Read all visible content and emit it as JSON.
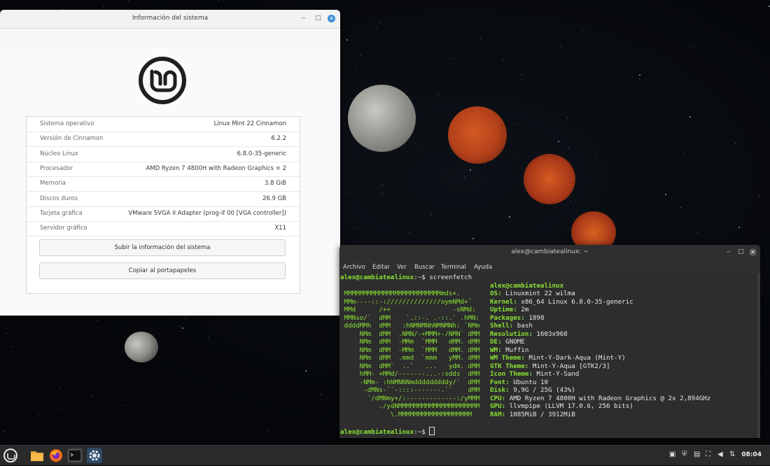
{
  "sysinfo": {
    "title": "Información del sistema",
    "rows": [
      {
        "label": "Sistema operativo",
        "value": "Linux Mint 22 Cinnamon"
      },
      {
        "label": "Versión de Cinnamon",
        "value": "6.2.2"
      },
      {
        "label": "Núcleo Linux",
        "value": "6.8.0-35-generic"
      },
      {
        "label": "Procesador",
        "value": "AMD Ryzen 7 4800H with Radeon Graphics × 2"
      },
      {
        "label": "Memoria",
        "value": "3.8 GiB"
      },
      {
        "label": "Discos duros",
        "value": "26.9 GB"
      },
      {
        "label": "Tarjeta gráfica",
        "value": "VMware SVGA II Adapter (prog-if 00 [VGA controller])"
      },
      {
        "label": "Servidor gráfico",
        "value": "X11"
      }
    ],
    "upload_button": "Subir la información del sistema",
    "copy_button": "Copiar al portapapeles"
  },
  "terminal": {
    "title": "alex@cambiatealinux: ~",
    "menu": [
      "Archivo",
      "Editar",
      "Ver",
      "Buscar",
      "Terminal",
      "Ayuda"
    ],
    "prompt": "alex@cambiatealinux",
    "prompt_suffix": ":~$ ",
    "command": "screenfetch",
    "logo_lines": [
      " MMMMMMMMMMMMMMMMMMMMMMMMMmds+.",
      " MMm----::-://////////////oymNMd+`",
      " MMd      /++                -sNMd:",
      " MMNso/`  dMM    `.::-. .-::.` .hMN:",
      " ddddMMh  dMM   :hNMNMNhNMNMNh: `NMm",
      "     NMm  dMM  .NMN/-+MMM+-/NMN` dMM",
      "     NMm  dMM  -MMm  `MMM   dMM. dMM",
      "     NMm  dMM  -MMm  `MMM   dMM. dMM",
      "     NMm  dMM  .mmd  `mmm   yMM. dMM",
      "     NMm  dMM`  ..`   ...   ydm. dMM",
      "     hMM- +MMd/-------...-:sdds  dMM",
      "     -NMm- :hNMNNNmdddddddddy/`  dMM",
      "      -dMNs-``-::::-------.``    dMM",
      "       `/dMNmy+/:-------------:/yMMM",
      "          ./ydNMMMMMMMMMMMMMMMMMMMMM",
      "             \\.MMMMMMMMMMMMMMMMMMM"
    ],
    "user_host": "alex@cambiatealinux",
    "info": [
      {
        "key": "OS",
        "value": "Linuxmint 22 wilma"
      },
      {
        "key": "Kernel",
        "value": "x86_64 Linux 6.8.0-35-generic"
      },
      {
        "key": "Uptime",
        "value": "2m"
      },
      {
        "key": "Packages",
        "value": "1898"
      },
      {
        "key": "Shell",
        "value": "bash"
      },
      {
        "key": "Resolution",
        "value": "1603x968"
      },
      {
        "key": "DE",
        "value": "GNOME"
      },
      {
        "key": "WM",
        "value": "Muffin"
      },
      {
        "key": "WM Theme",
        "value": "Mint-Y-Dark-Aqua (Mint-Y)"
      },
      {
        "key": "GTK Theme",
        "value": "Mint-Y-Aqua [GTK2/3]"
      },
      {
        "key": "Icon Theme",
        "value": "Mint-Y-Sand"
      },
      {
        "key": "Font",
        "value": "Ubuntu 10"
      },
      {
        "key": "Disk",
        "value": "9,9G / 25G (43%)"
      },
      {
        "key": "CPU",
        "value": "AMD Ryzen 7 4800H with Radeon Graphics @ 2x 2,894GHz"
      },
      {
        "key": "GPU",
        "value": "llvmpipe (LLVM 17.0.6, 256 bits)"
      },
      {
        "key": "RAM",
        "value": "1085MiB / 3912MiB"
      }
    ]
  },
  "taskbar": {
    "clock": "08:04",
    "apps": [
      "menu-icon",
      "files-icon",
      "firefox-icon",
      "terminal-icon",
      "settings-icon"
    ],
    "tray": [
      "clipboard-icon",
      "shield-icon",
      "network-manager-icon",
      "updates-icon",
      "network-icon",
      "volume-icon",
      "battery-icon"
    ]
  },
  "colors": {
    "accent": "#3b8fd8",
    "terminal_green": "#8ae234",
    "terminal_bg": "#2d2d2d",
    "taskbar_bg": "#2a2a2a"
  }
}
